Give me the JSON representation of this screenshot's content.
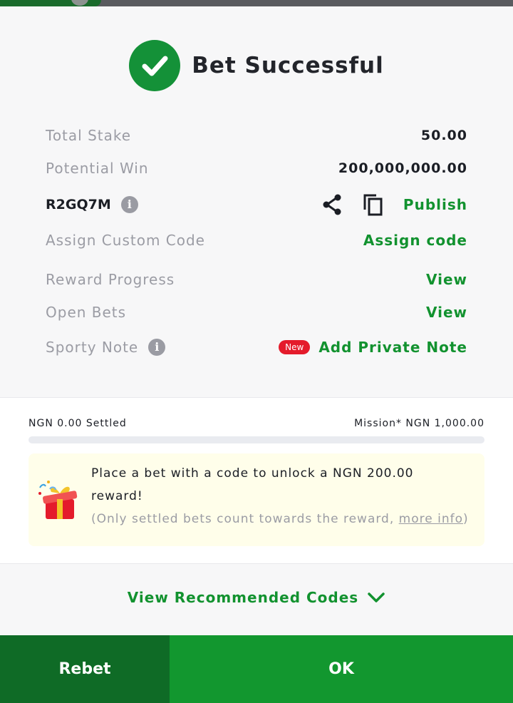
{
  "header": {
    "title": "Bet Successful"
  },
  "rows": {
    "total_stake": {
      "label": "Total Stake",
      "value": "50.00"
    },
    "potential_win": {
      "label": "Potential Win",
      "value": "200,000,000.00"
    },
    "booking_code": {
      "code": "R2GQ7M",
      "publish_label": "Publish"
    },
    "custom_code": {
      "label": "Assign Custom Code",
      "action": "Assign code"
    },
    "reward_progress": {
      "label": "Reward Progress",
      "action": "View"
    },
    "open_bets": {
      "label": "Open Bets",
      "action": "View"
    },
    "sporty_note": {
      "label": "Sporty Note",
      "badge": "New",
      "action": "Add Private Note"
    }
  },
  "mission": {
    "settled": "NGN 0.00 Settled",
    "target": "Mission* NGN 1,000.00",
    "progress_fraction": 0
  },
  "promo": {
    "line1": "Place a bet with a code to unlock a NGN 200.00 reward!",
    "note_prefix": "(Only settled bets count towards the reward, ",
    "link": "more info",
    "note_suffix": ")"
  },
  "recommend": {
    "label": "View Recommended Codes"
  },
  "footer": {
    "rebet": "Rebet",
    "ok": "OK"
  },
  "icons": {
    "success": "check-circle-icon",
    "share": "share-icon",
    "copy": "copy-icon",
    "info": "info-icon",
    "gift": "gift-icon",
    "chevron": "chevron-down-icon"
  },
  "colors": {
    "accent": "#12922f",
    "success": "#149138",
    "badge": "#e41b2b",
    "rebet_bg": "#0f6b26",
    "ok_bg": "#12972f"
  }
}
